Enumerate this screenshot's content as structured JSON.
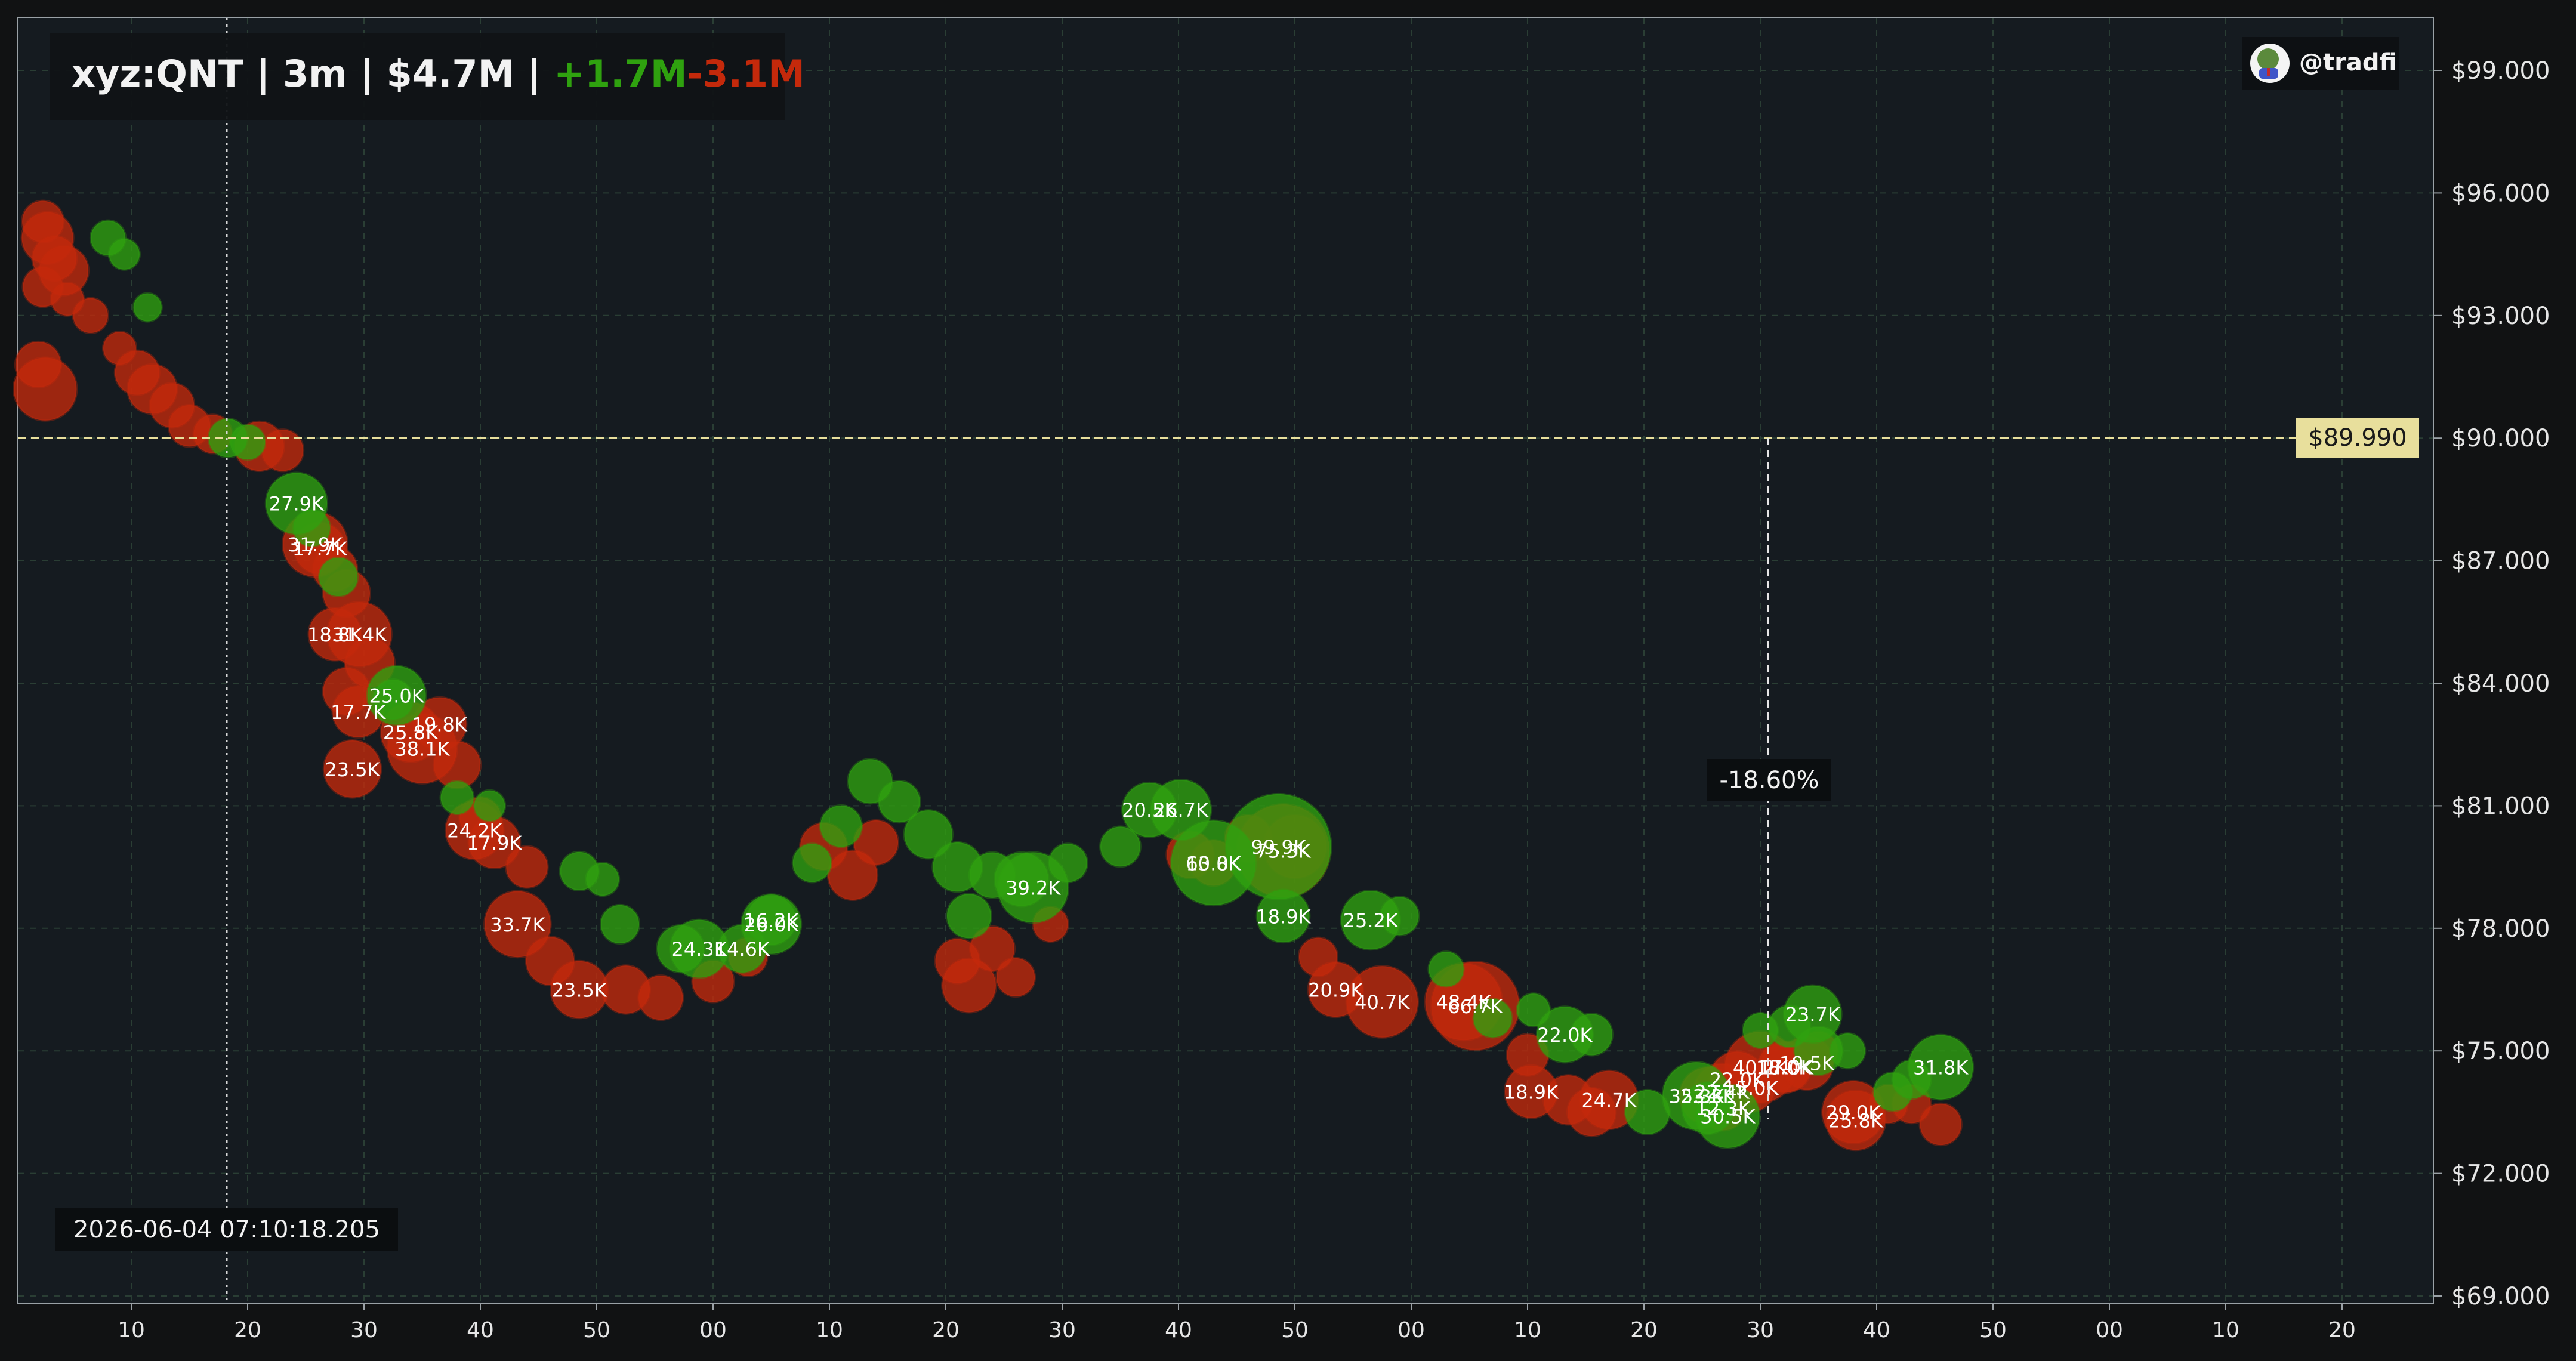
{
  "header": {
    "symbol": "xyz:QNT",
    "sep1": " | ",
    "interval": "3m",
    "sep2": " | ",
    "volume": "$4.7M",
    "sep3": " | ",
    "buy_volume": "+1.7M",
    "sell_volume": "-3.1M"
  },
  "badge": {
    "handle": "@tradfi"
  },
  "crosshair": {
    "time_label": "2026-06-04 07:10:18.205",
    "price_label": "$89.990",
    "change_label": "-18.60%"
  },
  "colors": {
    "background": "#151b20",
    "buy": "#2fa10f",
    "sell": "#c4290b",
    "price_tag": "#e8df9c",
    "axis_text": "#e6e6e6"
  },
  "chart_data": {
    "type": "scatter",
    "title": "xyz:QNT | 3m | $4.7M | +1.7M-3.1M",
    "xlabel": "",
    "ylabel": "",
    "x_tick_labels": [
      "10",
      "20",
      "30",
      "40",
      "50",
      "00",
      "10",
      "20",
      "30",
      "40",
      "50",
      "00",
      "10",
      "20",
      "30",
      "40",
      "50",
      "00",
      "10",
      "20"
    ],
    "y_ticks": [
      69,
      72,
      75,
      78,
      81,
      84,
      87,
      90,
      93,
      96,
      99
    ],
    "y_tick_labels": [
      "$69.000",
      "$72.000",
      "$75.000",
      "$78.000",
      "$81.000",
      "$84.000",
      "$87.000",
      "$90.000",
      "$93.000",
      "$96.000",
      "$99.000"
    ],
    "ylim": [
      68.8,
      100.3
    ],
    "x_unit": "tick index (10 minutes per tick)",
    "xlim": [
      -0.98,
      19.8
    ],
    "grid": true,
    "reference_price": 89.99,
    "series": [
      {
        "name": "Buy",
        "points": [
          {
            "x": -0.2,
            "y": 94.9,
            "v": 6
          },
          {
            "x": -0.06,
            "y": 94.5,
            "v": 4
          },
          {
            "x": 0.14,
            "y": 93.2,
            "v": 3
          },
          {
            "x": 0.83,
            "y": 90.0,
            "v": 8
          },
          {
            "x": 1.0,
            "y": 89.9,
            "v": 6
          },
          {
            "x": 1.42,
            "y": 88.4,
            "v": 27.9,
            "l": "27.9K"
          },
          {
            "x": 1.55,
            "y": 87.8,
            "v": 7
          },
          {
            "x": 1.78,
            "y": 86.6,
            "v": 8
          },
          {
            "x": 2.25,
            "y": 83.6,
            "v": 9
          },
          {
            "x": 2.28,
            "y": 83.7,
            "v": 25.0,
            "l": "25.0K"
          },
          {
            "x": 2.8,
            "y": 81.2,
            "v": 5
          },
          {
            "x": 3.08,
            "y": 81.0,
            "v": 4
          },
          {
            "x": 3.85,
            "y": 79.4,
            "v": 8
          },
          {
            "x": 4.05,
            "y": 79.2,
            "v": 5
          },
          {
            "x": 4.2,
            "y": 78.1,
            "v": 8
          },
          {
            "x": 4.72,
            "y": 77.5,
            "v": 14
          },
          {
            "x": 4.88,
            "y": 77.5,
            "v": 24.3,
            "l": "24.3K"
          },
          {
            "x": 5.25,
            "y": 77.5,
            "v": 14.6,
            "l": "14.6K"
          },
          {
            "x": 5.5,
            "y": 78.1,
            "v": 26.0,
            "l": "26.0K"
          },
          {
            "x": 5.5,
            "y": 78.2,
            "v": 16.2,
            "l": "16.2K"
          },
          {
            "x": 5.85,
            "y": 79.6,
            "v": 8
          },
          {
            "x": 6.1,
            "y": 80.5,
            "v": 10
          },
          {
            "x": 6.35,
            "y": 81.6,
            "v": 12
          },
          {
            "x": 6.6,
            "y": 81.1,
            "v": 10
          },
          {
            "x": 6.85,
            "y": 80.3,
            "v": 15
          },
          {
            "x": 7.1,
            "y": 79.5,
            "v": 16
          },
          {
            "x": 7.2,
            "y": 78.3,
            "v": 12
          },
          {
            "x": 7.4,
            "y": 79.3,
            "v": 13
          },
          {
            "x": 7.65,
            "y": 79.2,
            "v": 20
          },
          {
            "x": 7.75,
            "y": 79.0,
            "v": 39.2,
            "l": "39.2K"
          },
          {
            "x": 8.05,
            "y": 79.6,
            "v": 8
          },
          {
            "x": 8.5,
            "y": 80.0,
            "v": 9
          },
          {
            "x": 8.75,
            "y": 80.9,
            "v": 20.5,
            "l": "20.5K"
          },
          {
            "x": 9.02,
            "y": 80.9,
            "v": 26.7,
            "l": "26.7K"
          },
          {
            "x": 9.3,
            "y": 79.6,
            "v": 60.8,
            "l": "60.8K"
          },
          {
            "x": 9.86,
            "y": 80.0,
            "v": 99.9,
            "l": "99.9K"
          },
          {
            "x": 9.9,
            "y": 78.3,
            "v": 18.9,
            "l": "18.9K"
          },
          {
            "x": 10.65,
            "y": 78.2,
            "v": 25.2,
            "l": "25.2K"
          },
          {
            "x": 10.9,
            "y": 78.3,
            "v": 8
          },
          {
            "x": 11.3,
            "y": 77.0,
            "v": 6
          },
          {
            "x": 11.7,
            "y": 75.8,
            "v": 8
          },
          {
            "x": 12.05,
            "y": 76.0,
            "v": 5
          },
          {
            "x": 12.32,
            "y": 75.4,
            "v": 22.0,
            "l": "22.0K"
          },
          {
            "x": 12.55,
            "y": 75.4,
            "v": 10
          },
          {
            "x": 13.03,
            "y": 73.5,
            "v": 12
          },
          {
            "x": 13.45,
            "y": 73.9,
            "v": 35.3,
            "l": "35.3K"
          },
          {
            "x": 13.55,
            "y": 73.6,
            "v": 18
          },
          {
            "x": 13.72,
            "y": 73.4,
            "v": 30.5,
            "l": "30.5K"
          },
          {
            "x": 14.0,
            "y": 75.5,
            "v": 6
          },
          {
            "x": 14.25,
            "y": 75.6,
            "v": 10
          },
          {
            "x": 14.5,
            "y": 75.0,
            "v": 15
          },
          {
            "x": 14.45,
            "y": 75.9,
            "v": 23.7,
            "l": "23.7K"
          },
          {
            "x": 14.75,
            "y": 75.0,
            "v": 6
          },
          {
            "x": 15.14,
            "y": 74.0,
            "v": 8
          },
          {
            "x": 15.55,
            "y": 74.6,
            "v": 31.8,
            "l": "31.8K"
          },
          {
            "x": 15.3,
            "y": 74.3,
            "v": 8
          }
        ]
      },
      {
        "name": "Sell",
        "points": [
          {
            "x": -0.76,
            "y": 95.3,
            "v": 10
          },
          {
            "x": -0.72,
            "y": 94.9,
            "v": 18
          },
          {
            "x": -0.66,
            "y": 94.4,
            "v": 12
          },
          {
            "x": -0.58,
            "y": 94.1,
            "v": 16
          },
          {
            "x": -0.76,
            "y": 93.7,
            "v": 9
          },
          {
            "x": -0.8,
            "y": 91.8,
            "v": 13
          },
          {
            "x": -0.74,
            "y": 91.2,
            "v": 30
          },
          {
            "x": -0.55,
            "y": 93.4,
            "v": 5
          },
          {
            "x": -0.35,
            "y": 93.0,
            "v": 6
          },
          {
            "x": -0.1,
            "y": 92.2,
            "v": 5
          },
          {
            "x": 0.05,
            "y": 91.6,
            "v": 12
          },
          {
            "x": 0.18,
            "y": 91.2,
            "v": 16
          },
          {
            "x": 0.35,
            "y": 90.8,
            "v": 12
          },
          {
            "x": 0.5,
            "y": 90.3,
            "v": 10
          },
          {
            "x": 0.7,
            "y": 90.1,
            "v": 8
          },
          {
            "x": 1.1,
            "y": 89.8,
            "v": 16
          },
          {
            "x": 1.3,
            "y": 89.7,
            "v": 10
          },
          {
            "x": 1.58,
            "y": 87.4,
            "v": 31.9,
            "l": "31.9K"
          },
          {
            "x": 1.62,
            "y": 87.3,
            "v": 17.7,
            "l": "17.7K"
          },
          {
            "x": 1.75,
            "y": 86.8,
            "v": 12
          },
          {
            "x": 1.85,
            "y": 86.2,
            "v": 14
          },
          {
            "x": 1.75,
            "y": 85.2,
            "v": 18.8,
            "l": "18.8K"
          },
          {
            "x": 1.96,
            "y": 85.2,
            "v": 31.4,
            "l": "31.4K"
          },
          {
            "x": 2.05,
            "y": 84.5,
            "v": 16
          },
          {
            "x": 1.85,
            "y": 83.8,
            "v": 14
          },
          {
            "x": 1.95,
            "y": 83.3,
            "v": 17.7,
            "l": "17.7K"
          },
          {
            "x": 1.9,
            "y": 81.9,
            "v": 23.5,
            "l": "23.5K"
          },
          {
            "x": 2.4,
            "y": 82.8,
            "v": 25.8,
            "l": "25.8K"
          },
          {
            "x": 2.5,
            "y": 82.4,
            "v": 38.1,
            "l": "38.1K"
          },
          {
            "x": 2.65,
            "y": 83.0,
            "v": 19.8,
            "l": "19.8K"
          },
          {
            "x": 2.8,
            "y": 82.0,
            "v": 14
          },
          {
            "x": 3.0,
            "y": 80.7,
            "v": 10
          },
          {
            "x": 2.95,
            "y": 80.4,
            "v": 24.2,
            "l": "24.2K"
          },
          {
            "x": 3.12,
            "y": 80.1,
            "v": 17.9,
            "l": "17.9K"
          },
          {
            "x": 3.4,
            "y": 79.5,
            "v": 10
          },
          {
            "x": 3.32,
            "y": 78.1,
            "v": 33.7,
            "l": "33.7K"
          },
          {
            "x": 3.6,
            "y": 77.2,
            "v": 15
          },
          {
            "x": 3.85,
            "y": 76.5,
            "v": 23.5,
            "l": "23.5K"
          },
          {
            "x": 4.25,
            "y": 76.5,
            "v": 15
          },
          {
            "x": 4.55,
            "y": 76.3,
            "v": 12
          },
          {
            "x": 5.0,
            "y": 76.7,
            "v": 10
          },
          {
            "x": 5.3,
            "y": 77.3,
            "v": 8
          },
          {
            "x": 5.95,
            "y": 80.0,
            "v": 14
          },
          {
            "x": 6.2,
            "y": 79.3,
            "v": 16
          },
          {
            "x": 6.4,
            "y": 80.1,
            "v": 12
          },
          {
            "x": 7.1,
            "y": 77.2,
            "v": 12
          },
          {
            "x": 7.2,
            "y": 76.6,
            "v": 20
          },
          {
            "x": 7.4,
            "y": 77.5,
            "v": 12
          },
          {
            "x": 7.6,
            "y": 76.8,
            "v": 8
          },
          {
            "x": 7.9,
            "y": 78.1,
            "v": 6
          },
          {
            "x": 9.1,
            "y": 79.8,
            "v": 14
          },
          {
            "x": 9.3,
            "y": 79.6,
            "v": 13.0,
            "l": "13.0K"
          },
          {
            "x": 9.6,
            "y": 80.2,
            "v": 14
          },
          {
            "x": 9.9,
            "y": 79.9,
            "v": 75.3,
            "l": "75.3K"
          },
          {
            "x": 10.0,
            "y": 80.0,
            "v": 30
          },
          {
            "x": 10.2,
            "y": 77.3,
            "v": 8
          },
          {
            "x": 10.35,
            "y": 76.5,
            "v": 20.9,
            "l": "20.9K"
          },
          {
            "x": 10.75,
            "y": 76.2,
            "v": 40.7,
            "l": "40.7K"
          },
          {
            "x": 11.45,
            "y": 76.2,
            "v": 48.4,
            "l": "48.4K"
          },
          {
            "x": 11.55,
            "y": 76.1,
            "v": 66.7,
            "l": "66.7K"
          },
          {
            "x": 12.0,
            "y": 74.9,
            "v": 10
          },
          {
            "x": 12.03,
            "y": 74.0,
            "v": 18.9,
            "l": "18.9K"
          },
          {
            "x": 12.35,
            "y": 73.8,
            "v": 16
          },
          {
            "x": 12.55,
            "y": 73.5,
            "v": 15
          },
          {
            "x": 12.7,
            "y": 73.8,
            "v": 24.7,
            "l": "24.7K"
          },
          {
            "x": 13.55,
            "y": 73.9,
            "v": 23.3,
            "l": "23.3K"
          },
          {
            "x": 13.67,
            "y": 74.0,
            "v": 22.4,
            "l": "22.4K"
          },
          {
            "x": 13.68,
            "y": 73.6,
            "v": 12.3,
            "l": "12.3K"
          },
          {
            "x": 13.8,
            "y": 74.3,
            "v": 22.0,
            "l": "22.0K"
          },
          {
            "x": 13.92,
            "y": 74.1,
            "v": 15.0,
            "l": "15.0K"
          },
          {
            "x": 14.0,
            "y": 74.6,
            "v": 40.2,
            "l": "40.2K"
          },
          {
            "x": 14.2,
            "y": 74.6,
            "v": 18.0,
            "l": "18.0K"
          },
          {
            "x": 14.22,
            "y": 74.6,
            "v": 17.0,
            "l": "17.0K"
          },
          {
            "x": 14.4,
            "y": 74.7,
            "v": 19.5,
            "l": "19.5K"
          },
          {
            "x": 14.5,
            "y": 75.0,
            "v": 8
          },
          {
            "x": 14.8,
            "y": 73.5,
            "v": 29.0,
            "l": "29.0K"
          },
          {
            "x": 14.82,
            "y": 73.3,
            "v": 25.8,
            "l": "25.8K"
          },
          {
            "x": 15.1,
            "y": 73.7,
            "v": 8
          },
          {
            "x": 15.3,
            "y": 73.7,
            "v": 8
          },
          {
            "x": 15.55,
            "y": 73.2,
            "v": 10
          }
        ]
      }
    ]
  }
}
